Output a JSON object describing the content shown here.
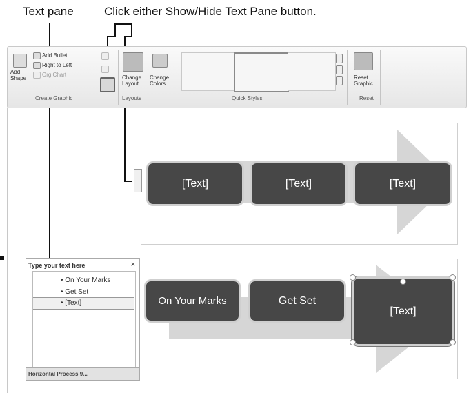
{
  "callouts": {
    "text_pane": "Text pane",
    "click_button": "Click either Show/Hide Text Pane button."
  },
  "ribbon": {
    "create_graphic": {
      "add_shape": "Add\nShape",
      "add_bullet": "Add Bullet",
      "right_to_left": "Right to Left",
      "org_chart": "Org Chart",
      "label": "Create Graphic"
    },
    "layouts": {
      "change_layout": "Change\nLayout",
      "label": "Layouts"
    },
    "quick_styles": {
      "change_colors": "Change\nColors",
      "label": "Quick Styles"
    },
    "reset": {
      "reset_graphic": "Reset\nGraphic",
      "label": "Reset"
    }
  },
  "diagram_top": {
    "boxes": [
      "[Text]",
      "[Text]",
      "[Text]"
    ]
  },
  "text_pane": {
    "title": "Type your text here",
    "close": "×",
    "items": [
      "On Your Marks",
      "Get Set",
      "[Text]"
    ],
    "footer": "Horizontal Process 9..."
  },
  "diagram_bottom": {
    "boxes": [
      "On Your Marks",
      "Get Set",
      "[Text]"
    ]
  }
}
